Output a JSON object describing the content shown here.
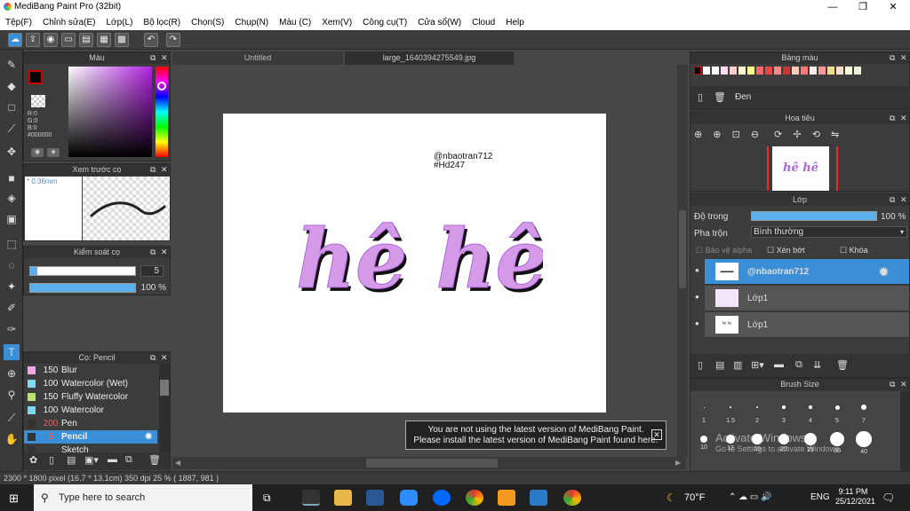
{
  "window": {
    "title": "MediBang Paint Pro (32bit)",
    "minimize": "—",
    "maximize": "❐",
    "close": "✕"
  },
  "menu": [
    "Tệp(F)",
    "Chỉnh sửa(E)",
    "Lớp(L)",
    "Bộ lọc(R)",
    "Chọn(S)",
    "Chụp(N)",
    "Màu (C)",
    "Xem(V)",
    "Công cụ(T)",
    "Cửa sổ(W)",
    "Cloud",
    "Help"
  ],
  "color_panel": {
    "title": "Màu",
    "primary": "#000000",
    "r": "R:0",
    "g": "G:0",
    "b": "B:0",
    "hex": "#000000"
  },
  "preview_panel": {
    "title": "Xem trước cọ",
    "size": "* 0.36mm"
  },
  "brush_control": {
    "title": "Kiểm soát cọ",
    "size": "5",
    "opacity": "100 %",
    "opacity_value": 1.0
  },
  "brush_panel": {
    "title": "Cọ: Pencil",
    "items": [
      {
        "size": "150",
        "name": "Blur",
        "color": "#f4a6e6"
      },
      {
        "size": "100",
        "name": "Watercolor (Wet)",
        "color": "#7ad8f0"
      },
      {
        "size": "150",
        "name": "Fluffy Watercolor",
        "color": "#b7e26a"
      },
      {
        "size": "100",
        "name": "Watercolor",
        "color": "#7ad8f0"
      },
      {
        "size": "200",
        "name": "Pen",
        "color": "#333333"
      },
      {
        "size": "5",
        "name": "Pencil",
        "color": "#333333"
      },
      {
        "size": "",
        "name": "Sketch",
        "color": "#333333"
      }
    ]
  },
  "tabs": [
    "Untitled",
    "large_1640394275549.jpg"
  ],
  "canvas": {
    "line1": "@nbaotran712",
    "line2": "#Hd247",
    "art": "hê hê"
  },
  "notice": {
    "line1": "You are not using the latest version of MediBang Paint.",
    "line2": "Please install the latest version of MediBang Paint found here.",
    "close": "✕"
  },
  "palette": {
    "title": "Bảng màu",
    "color_name": "Đen"
  },
  "navigator": {
    "title": "Hoa tiêu",
    "thumb_text": "hê hê"
  },
  "layer_panel": {
    "title": "Lớp",
    "opacity_label": "Độ trong",
    "opacity": "100 %",
    "blend_label": "Pha trộn",
    "blend": "Bình thường",
    "protect_alpha": "Bảo vệ alpha",
    "clip": "Xén bớt",
    "lock": "Khóa",
    "layers": [
      {
        "name": "@nbaotran712",
        "selected": true
      },
      {
        "name": "Lớp1",
        "selected": false
      },
      {
        "name": "Lớp1",
        "selected": false
      }
    ]
  },
  "brush_size": {
    "title": "Brush Size",
    "row1": [
      "1",
      "1.5",
      "2",
      "3",
      "4",
      "5",
      "7"
    ],
    "row2": [
      "10",
      "12",
      "15",
      "20",
      "25",
      "30",
      "40"
    ]
  },
  "watermark": {
    "line1": "Activate Windows",
    "line2": "Go to Settings to activate Windows."
  },
  "status": "2300 * 1800 pixel   (16.7 * 13.1cm)   350 dpi   25 %   ( 1887, 981 )",
  "taskbar": {
    "search": "Type here to search",
    "weather": "70°F",
    "lang": "ENG",
    "time": "9:11 PM",
    "date": "25/12/2021"
  }
}
